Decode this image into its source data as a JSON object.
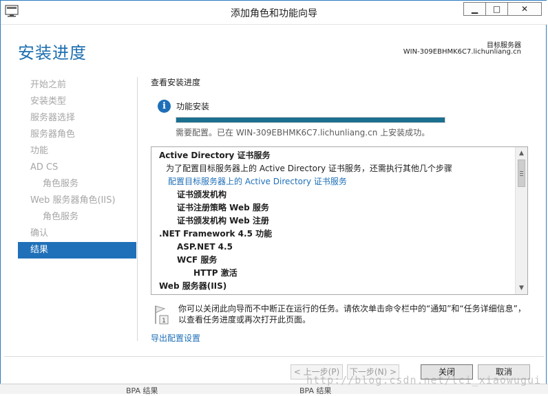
{
  "window": {
    "title": "添加角色和功能向导",
    "min_glyph": "▁",
    "max_glyph": "□",
    "close_glyph": "✕"
  },
  "header": {
    "page_title": "安装进度",
    "server_label": "目标服务器",
    "server_name": "WIN-309EBHMK6C7.lichunliang.cn"
  },
  "nav": {
    "items": [
      {
        "label": "开始之前",
        "state": "disabled",
        "level": 0
      },
      {
        "label": "安装类型",
        "state": "disabled",
        "level": 0
      },
      {
        "label": "服务器选择",
        "state": "disabled",
        "level": 0
      },
      {
        "label": "服务器角色",
        "state": "disabled",
        "level": 0
      },
      {
        "label": "功能",
        "state": "disabled",
        "level": 0
      },
      {
        "label": "AD CS",
        "state": "disabled",
        "level": 0
      },
      {
        "label": "角色服务",
        "state": "disabled",
        "level": 1
      },
      {
        "label": "Web 服务器角色(IIS)",
        "state": "disabled",
        "level": 0
      },
      {
        "label": "角色服务",
        "state": "disabled",
        "level": 1
      },
      {
        "label": "确认",
        "state": "disabled",
        "level": 0
      },
      {
        "label": "结果",
        "state": "active",
        "level": 0
      }
    ]
  },
  "main": {
    "section_label": "查看安装进度",
    "info_glyph": "i",
    "info_label": "功能安装",
    "progress_percent": 100,
    "progress_color": "#1b6f8f",
    "status": "需要配置。已在 WIN-309EBHMK6C7.lichunliang.cn 上安装成功。",
    "results": [
      {
        "text": "Active Directory 证书服务",
        "style": "bold",
        "indent": "lvl0"
      },
      {
        "text": "为了配置目标服务器上的 Active Directory 证书服务，还需执行其他几个步骤",
        "style": "normal",
        "indent": "lvl1"
      },
      {
        "text": "配置目标服务器上的 Active Directory 证书服务",
        "style": "link",
        "indent": "link"
      },
      {
        "text": "证书颁发机构",
        "style": "bold",
        "indent": "lvl1b"
      },
      {
        "text": "证书注册策略 Web 服务",
        "style": "bold",
        "indent": "lvl1b"
      },
      {
        "text": "证书颁发机构 Web 注册",
        "style": "bold",
        "indent": "lvl1b"
      },
      {
        "text": ".NET Framework 4.5 功能",
        "style": "bold",
        "indent": "lvl0"
      },
      {
        "text": "ASP.NET 4.5",
        "style": "bold",
        "indent": "lvl1b"
      },
      {
        "text": "WCF 服务",
        "style": "bold",
        "indent": "lvl1b"
      },
      {
        "text": "HTTP 激活",
        "style": "bold",
        "indent": "lvl2"
      },
      {
        "text": "Web 服务器(IIS)",
        "style": "bold",
        "indent": "lvl0"
      }
    ],
    "scroll_up_glyph": "▲",
    "scroll_down_glyph": "▼",
    "note": "你可以关闭此向导而不中断正在运行的任务。请依次单击命令栏中的“通知”和“任务详细信息”，以查看任务进度或再次打开此页面。",
    "note_badge": "1",
    "export_link": "导出配置设置"
  },
  "footer": {
    "prev_label": "< 上一步(P)",
    "next_label": "下一步(N) >",
    "close_label": "关闭",
    "cancel_label": "取消"
  },
  "background": {
    "left_text": "BPA 结果",
    "right_text": "BPA 结果"
  },
  "watermark": "http://blog.csdn.net/lci_xiaowugui"
}
